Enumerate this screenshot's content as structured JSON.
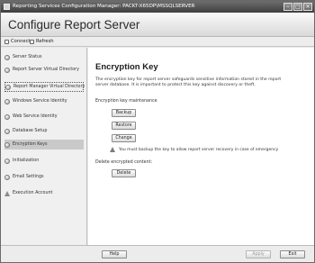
{
  "window": {
    "title": "Reporting Services Configuration Manager: PACKT-X65DP\\MSSQLSERVER"
  },
  "banner": {
    "title": "Configure Report Server"
  },
  "toolbar": {
    "connect_label": "Connect",
    "refresh_label": "Refresh"
  },
  "sidebar": {
    "items": [
      {
        "label": "Server Status"
      },
      {
        "label": "Report Server Virtual Directory"
      },
      {
        "label": "Report Manager Virtual Directory"
      },
      {
        "label": "Windows Service Identity"
      },
      {
        "label": "Web Service Identity"
      },
      {
        "label": "Database Setup"
      },
      {
        "label": "Encryption Keys"
      },
      {
        "label": "Initialization"
      },
      {
        "label": "Email Settings"
      },
      {
        "label": "Execution Account"
      }
    ]
  },
  "main": {
    "title": "Encryption Key",
    "description": "The encryption key for report server safeguards sensitive information stored in the report server database. It is important to protect this key against discovery or theft.",
    "maintenance_label": "Encryption key maintenance",
    "backup_label": "Backup",
    "restore_label": "Restore",
    "change_label": "Change",
    "warning_text": "You must backup the key to allow report server recovery in case of emergency",
    "delete_label": "Delete encrypted content:",
    "delete_button": "Delete"
  },
  "footer": {
    "help_label": "Help",
    "apply_label": "Apply",
    "exit_label": "Exit"
  }
}
